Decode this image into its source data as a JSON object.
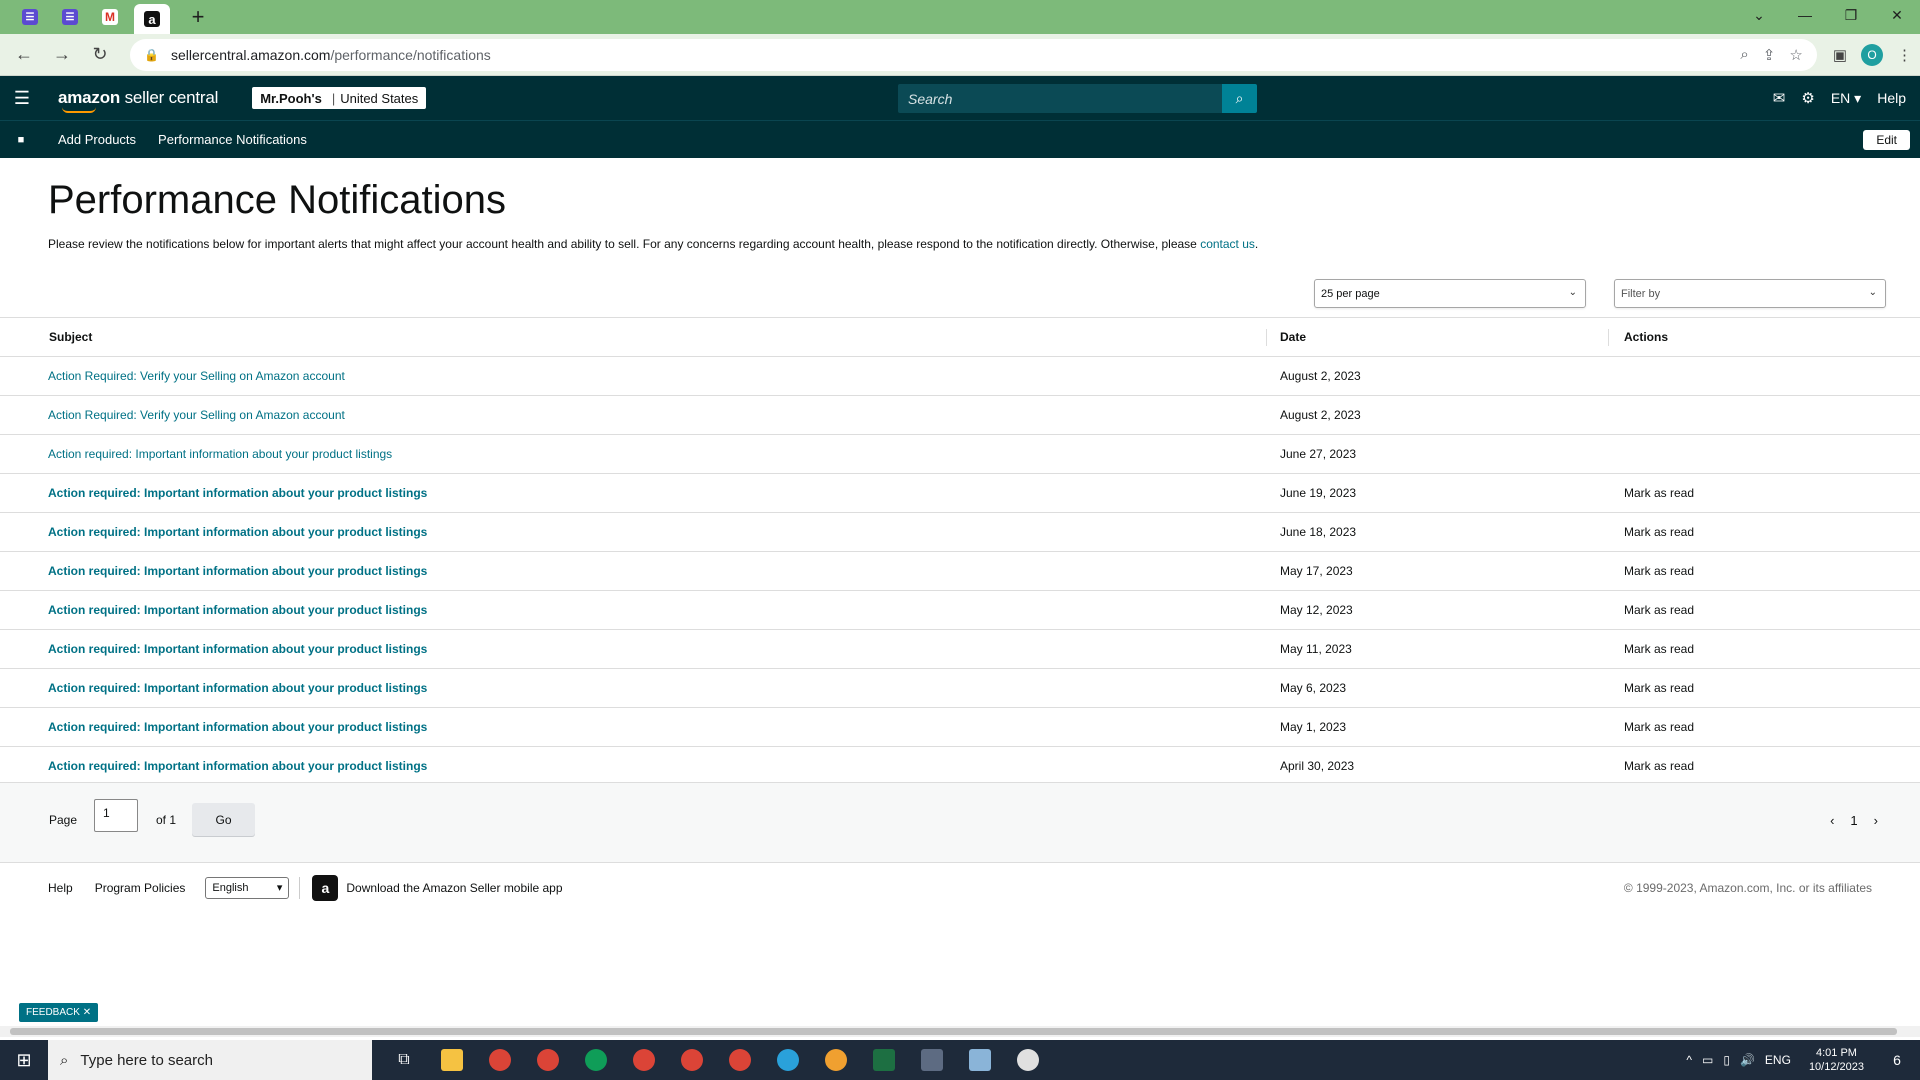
{
  "browser": {
    "url_host": "sellercentral.amazon.com",
    "url_path": "/performance/notifications",
    "profile_initial": "O"
  },
  "header": {
    "logo_brand": "amazon",
    "logo_product": "seller central",
    "store_name": "Mr.Pooh's",
    "store_region": "United States",
    "search_placeholder": "Search",
    "lang": "EN",
    "help": "Help"
  },
  "subnav": {
    "items": [
      "Add Products",
      "Performance Notifications"
    ],
    "edit": "Edit"
  },
  "main": {
    "title": "Performance Notifications",
    "description": "Please review the notifications below for important alerts that might affect your account health and ability to sell. For any concerns regarding account health, please respond to the notification directly. Otherwise, please ",
    "contact_link": "contact us",
    "per_page": "25 per page",
    "filter_placeholder": "Filter by"
  },
  "table": {
    "headers": {
      "subject": "Subject",
      "date": "Date",
      "actions": "Actions"
    },
    "rows": [
      {
        "subject": "Action Required: Verify your Selling on Amazon account",
        "date": "August 2, 2023",
        "action": "",
        "unread": false
      },
      {
        "subject": "Action Required: Verify your Selling on Amazon account",
        "date": "August 2, 2023",
        "action": "",
        "unread": false
      },
      {
        "subject": "Action required: Important information about your product listings",
        "date": "June 27, 2023",
        "action": "",
        "unread": false
      },
      {
        "subject": "Action required: Important information about your product listings",
        "date": "June 19, 2023",
        "action": "Mark as read",
        "unread": true
      },
      {
        "subject": "Action required: Important information about your product listings",
        "date": "June 18, 2023",
        "action": "Mark as read",
        "unread": true
      },
      {
        "subject": "Action required: Important information about your product listings",
        "date": "May 17, 2023",
        "action": "Mark as read",
        "unread": true
      },
      {
        "subject": "Action required: Important information about your product listings",
        "date": "May 12, 2023",
        "action": "Mark as read",
        "unread": true
      },
      {
        "subject": "Action required: Important information about your product listings",
        "date": "May 11, 2023",
        "action": "Mark as read",
        "unread": true
      },
      {
        "subject": "Action required: Important information about your product listings",
        "date": "May 6, 2023",
        "action": "Mark as read",
        "unread": true
      },
      {
        "subject": "Action required: Important information about your product listings",
        "date": "May 1, 2023",
        "action": "Mark as read",
        "unread": true
      },
      {
        "subject": "Action required: Important information about your product listings",
        "date": "April 30, 2023",
        "action": "Mark as read",
        "unread": true
      }
    ]
  },
  "pager": {
    "page_label": "Page",
    "page_value": "1",
    "of_label": "of 1",
    "go": "Go",
    "current": "1"
  },
  "footer": {
    "help": "Help",
    "policies": "Program Policies",
    "language": "English",
    "app_text": "Download the Amazon Seller mobile app",
    "copyright": "© 1999-2023, Amazon.com, Inc. or its affiliates"
  },
  "feedback": "FEEDBACK",
  "taskbar": {
    "search_placeholder": "Type here to search",
    "lang": "ENG",
    "time": "4:01 PM",
    "date": "10/12/2023",
    "notif_count": "6"
  },
  "colors": {
    "header_bg": "#002f36",
    "link": "#007185",
    "search_btn": "#008296",
    "tabstrip": "#7dba7a"
  }
}
